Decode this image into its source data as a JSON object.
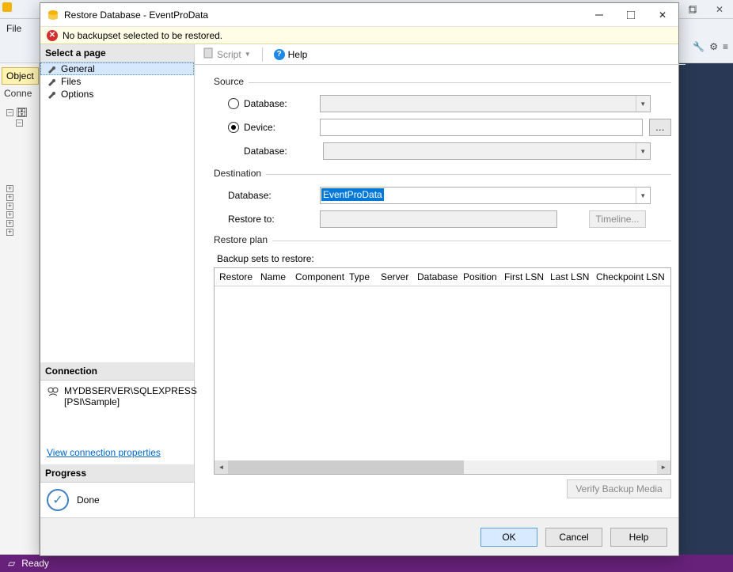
{
  "bg": {
    "file_menu": "File",
    "object_tab": "Object",
    "connect_label": "Conne",
    "status": "Ready"
  },
  "dialog": {
    "title": "Restore Database - EventProData",
    "warning": "No backupset selected to be restored.",
    "toolbar": {
      "script": "Script",
      "help": "Help"
    },
    "left": {
      "select_page": "Select a page",
      "pages": {
        "general": "General",
        "files": "Files",
        "options": "Options"
      },
      "connection_hdr": "Connection",
      "server": "MYDBSERVER\\SQLEXPRESS",
      "user": "[PSI\\Sample]",
      "view_conn": "View connection properties",
      "progress_hdr": "Progress",
      "progress_status": "Done"
    },
    "form": {
      "source_label": "Source",
      "database_radio": "Database:",
      "device_radio": "Device:",
      "src_db_label": "Database:",
      "dest_label": "Destination",
      "dest_db_label": "Database:",
      "dest_db_value": "EventProData",
      "restore_to_label": "Restore to:",
      "timeline_btn": "Timeline...",
      "restore_plan_label": "Restore plan",
      "backup_sets_label": "Backup sets to restore:",
      "grid_cols": [
        "Restore",
        "Name",
        "Component",
        "Type",
        "Server",
        "Database",
        "Position",
        "First LSN",
        "Last LSN",
        "Checkpoint LSN"
      ],
      "verify_btn": "Verify Backup Media"
    },
    "footer": {
      "ok": "OK",
      "cancel": "Cancel",
      "help": "Help"
    }
  }
}
